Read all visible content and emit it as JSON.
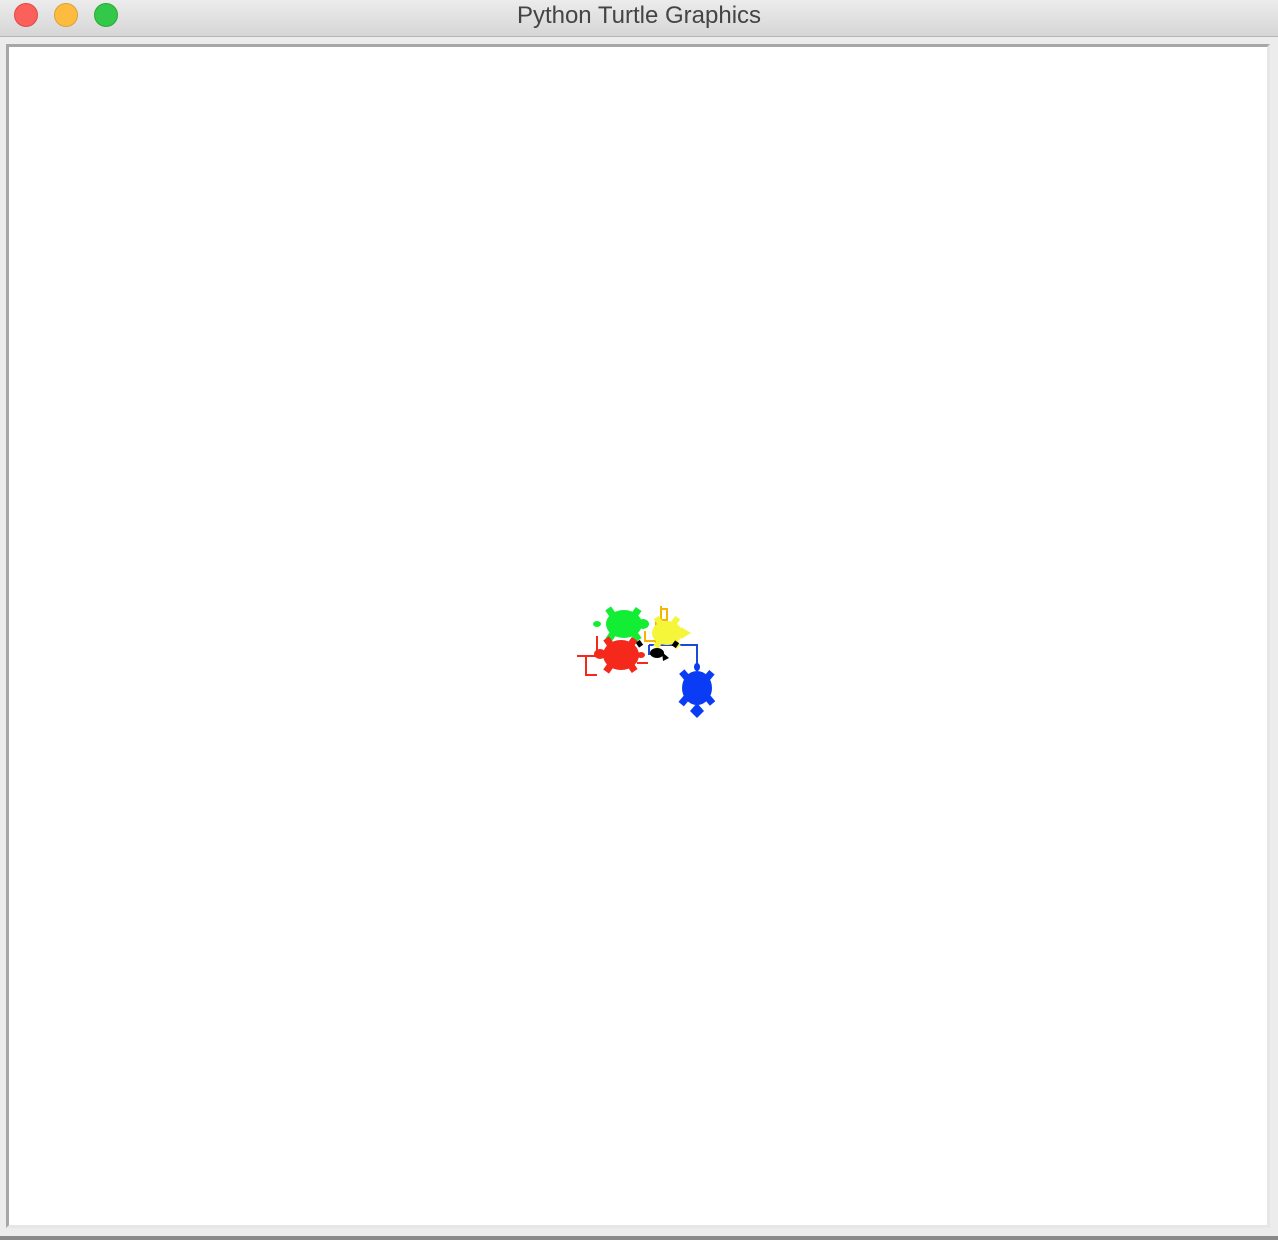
{
  "window": {
    "title": "Python Turtle Graphics"
  },
  "controls": {
    "close": "close-button",
    "minimize": "minimize-button",
    "zoom": "zoom-button"
  },
  "colors": {
    "close": "#fc605b",
    "minimize": "#fdbc40",
    "zoom": "#34c84a",
    "canvas_background": "#ffffff"
  },
  "turtles": [
    {
      "name": "green-turtle",
      "color": "#12ee33"
    },
    {
      "name": "yellow-turtle",
      "color": "#f5f53a"
    },
    {
      "name": "red-turtle",
      "color": "#f4291c"
    },
    {
      "name": "black-turtle",
      "color": "#000000"
    },
    {
      "name": "blue-turtle",
      "color": "#0b3cf5"
    }
  ],
  "trails": [
    {
      "name": "orange-trail",
      "color": "#f7b500"
    },
    {
      "name": "red-trail",
      "color": "#f4291c"
    },
    {
      "name": "blue-trail",
      "color": "#1b4ad8"
    }
  ]
}
